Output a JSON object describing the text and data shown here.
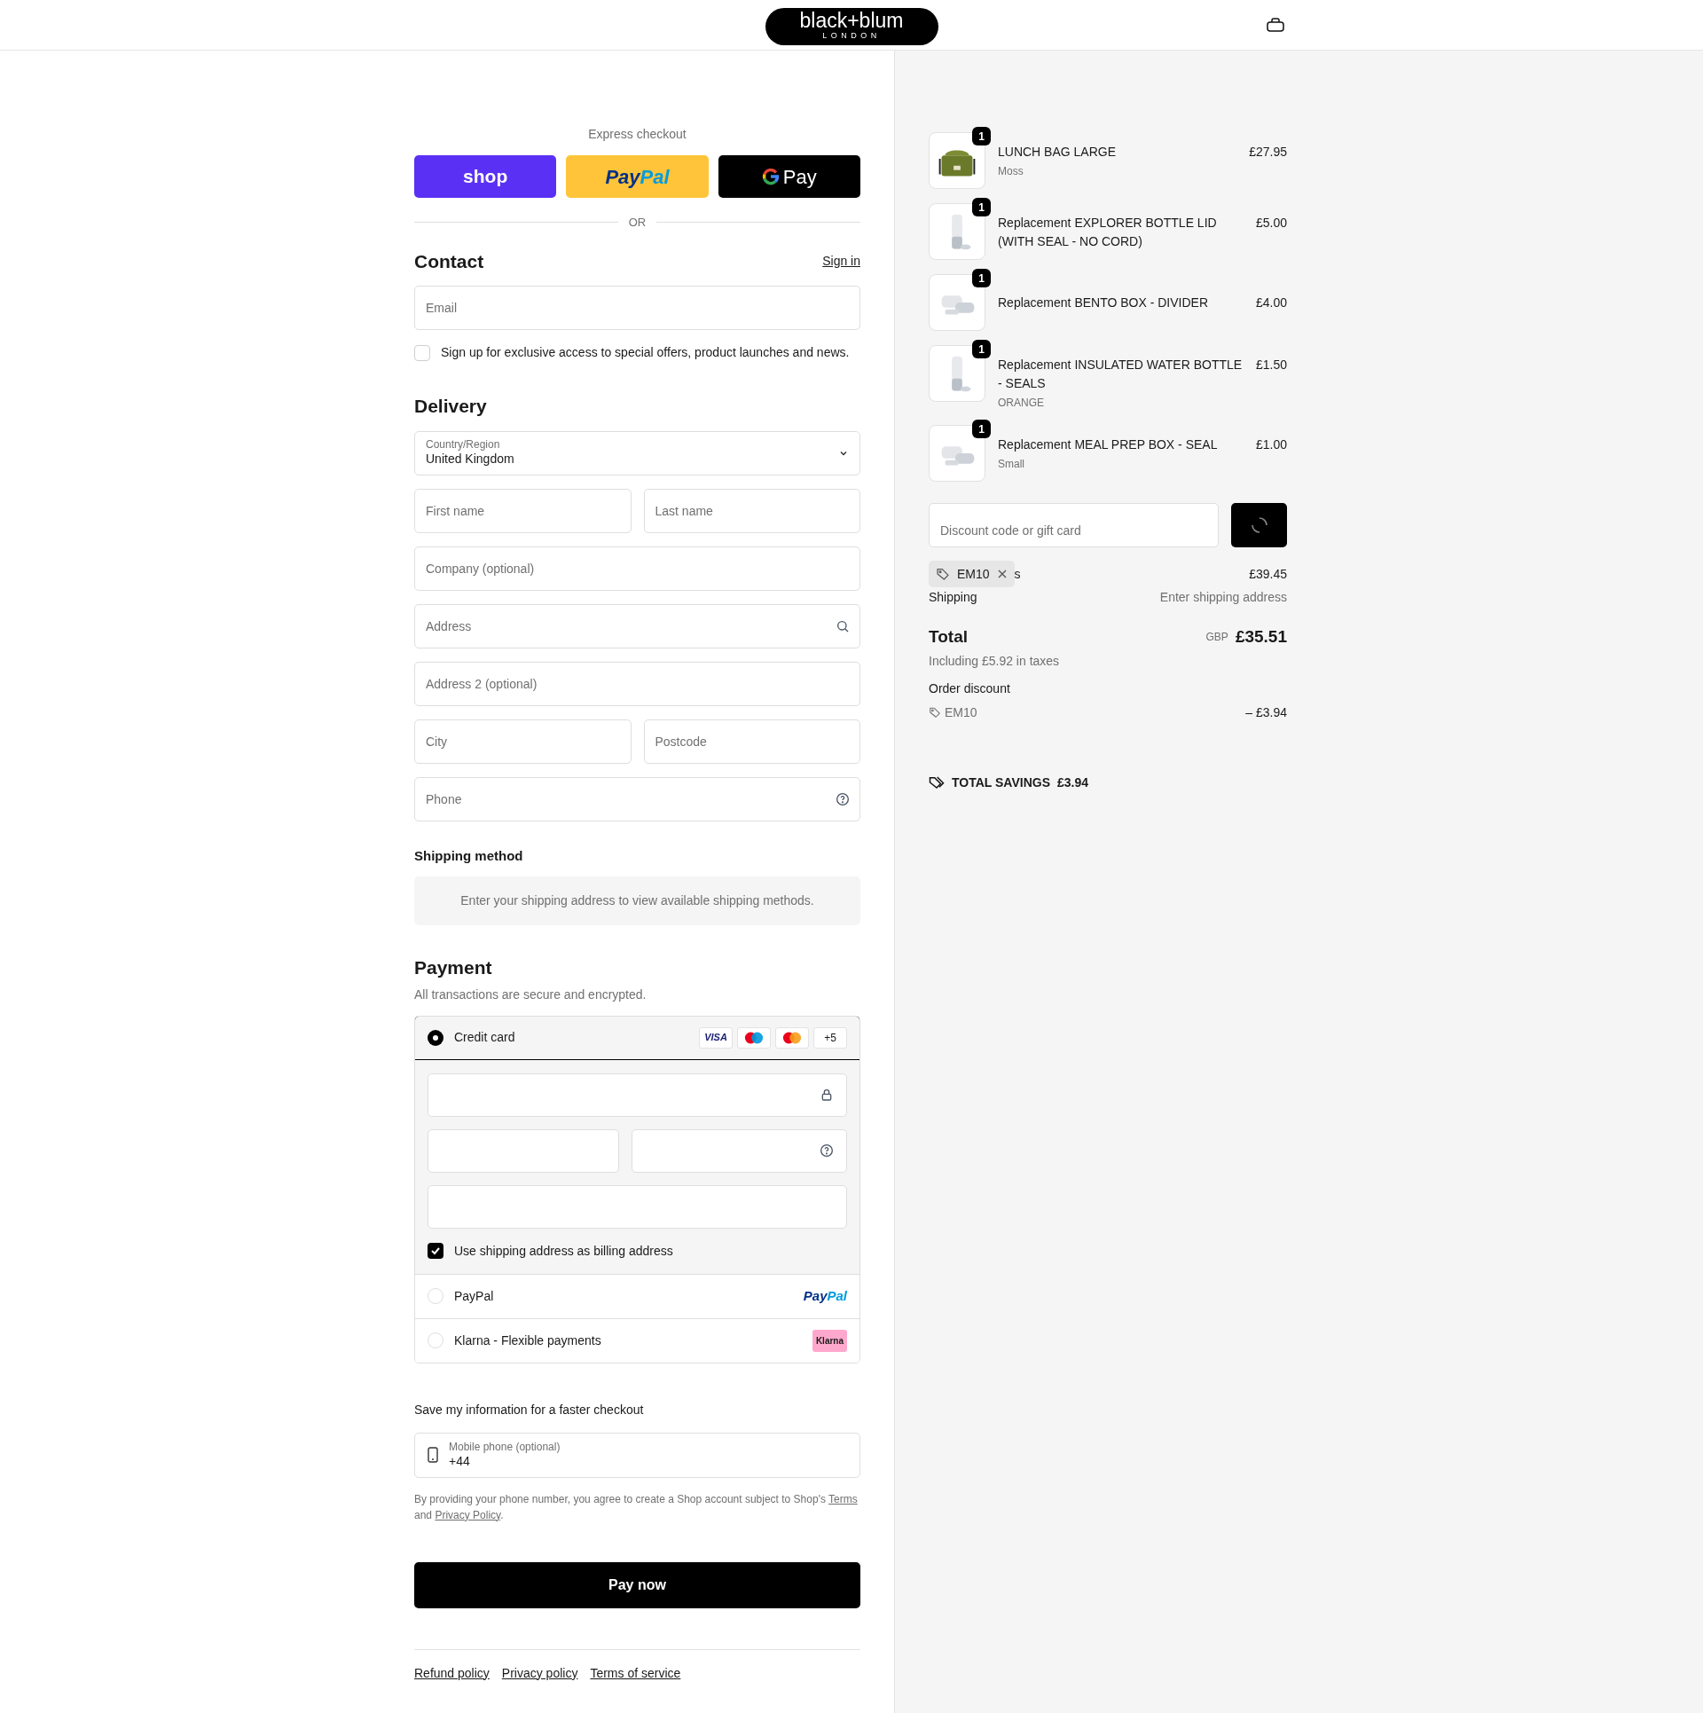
{
  "header": {
    "logo": {
      "wordmark": "black+blum",
      "subtitle": "LONDON"
    }
  },
  "express_checkout": {
    "title": "Express checkout",
    "buttons": [
      {
        "kind": "shop",
        "parts": [
          "shop"
        ]
      },
      {
        "kind": "paypal",
        "parts": [
          "Pay",
          "Pal"
        ]
      },
      {
        "kind": "gpay",
        "parts": [
          "Pay"
        ]
      }
    ],
    "divider": "OR"
  },
  "contact": {
    "title": "Contact",
    "sign_in": "Sign in",
    "email": {
      "placeholder": "Email"
    },
    "newsletter": {
      "label": "Sign up for exclusive access to special offers, product launches and news.",
      "checked": false
    }
  },
  "delivery": {
    "title": "Delivery",
    "country": {
      "label": "Country/Region",
      "value": "United Kingdom"
    },
    "rows": [
      [
        {
          "placeholder": "First name"
        },
        {
          "placeholder": "Last name"
        }
      ],
      [
        {
          "placeholder": "Company (optional)"
        }
      ],
      [
        {
          "placeholder": "Address",
          "kind": "search"
        }
      ],
      [
        {
          "placeholder": "Address 2 (optional)"
        }
      ],
      [
        {
          "placeholder": "City"
        },
        {
          "placeholder": "Postcode"
        }
      ],
      [
        {
          "placeholder": "Phone",
          "kind": "help"
        }
      ]
    ]
  },
  "shipping_method": {
    "title": "Shipping method",
    "notice": "Enter your shipping address to view available shipping methods."
  },
  "payment": {
    "title": "Payment",
    "subtitle": "All transactions are secure and encrypted.",
    "methods": [
      {
        "kind": "card",
        "label": "Credit card",
        "selected": true,
        "brands": [
          {
            "kind": "visa",
            "label": "VISA"
          },
          {
            "kind": "maestro"
          },
          {
            "kind": "mastercard"
          }
        ],
        "more": "+5"
      },
      {
        "kind": "paypal",
        "label": "PayPal",
        "selected": false,
        "logo": [
          "Pay",
          "Pal"
        ]
      },
      {
        "kind": "klarna",
        "label": "Klarna - Flexible payments",
        "selected": false,
        "logo": "Klarna"
      }
    ],
    "billing_same": {
      "label": "Use shipping address as billing address",
      "checked": true
    }
  },
  "save_info": {
    "title": "Save my information for a faster checkout",
    "phone": {
      "label": "Mobile phone (optional)",
      "value": "+44"
    },
    "legal": {
      "before": "By providing your phone number, you agree to create a Shop account subject to Shop's",
      "link1": "Terms",
      "middle": "and",
      "link2": "Privacy Policy",
      "after": "."
    }
  },
  "pay_button": "Pay now",
  "footer_links": [
    "Refund policy",
    "Privacy policy",
    "Terms of service"
  ],
  "order": {
    "items": [
      {
        "kind": "bag",
        "quantity": "1",
        "name": "LUNCH BAG LARGE",
        "variant": "Moss",
        "price": "£27.95"
      },
      {
        "kind": "bottle",
        "quantity": "1",
        "name": "Replacement EXPLORER BOTTLE LID (WITH SEAL - NO CORD)",
        "price": "£5.00"
      },
      {
        "kind": "box",
        "quantity": "1",
        "name": "Replacement BENTO BOX - DIVIDER",
        "price": "£4.00"
      },
      {
        "kind": "bottle",
        "quantity": "1",
        "name": "Replacement INSULATED WATER BOTTLE - SEALS",
        "variant": "ORANGE",
        "price": "£1.50"
      },
      {
        "kind": "box",
        "quantity": "1",
        "name": "Replacement MEAL PREP BOX - SEAL",
        "variant": "Small",
        "price": "£1.00"
      }
    ],
    "discount": {
      "placeholder": "Discount code or gift card"
    },
    "applied_code": "EM10",
    "subtotal": {
      "label": "s",
      "value": "£39.45"
    },
    "shipping": {
      "label": "Shipping",
      "value": "Enter shipping address"
    },
    "total": {
      "label": "Total",
      "currency": "GBP",
      "value": "£35.51",
      "tax_note": "Including £5.92 in taxes"
    },
    "order_discount": {
      "label": "Order discount",
      "code": "EM10",
      "value": "– £3.94"
    },
    "savings": {
      "label": "TOTAL SAVINGS",
      "value": "£3.94"
    }
  }
}
